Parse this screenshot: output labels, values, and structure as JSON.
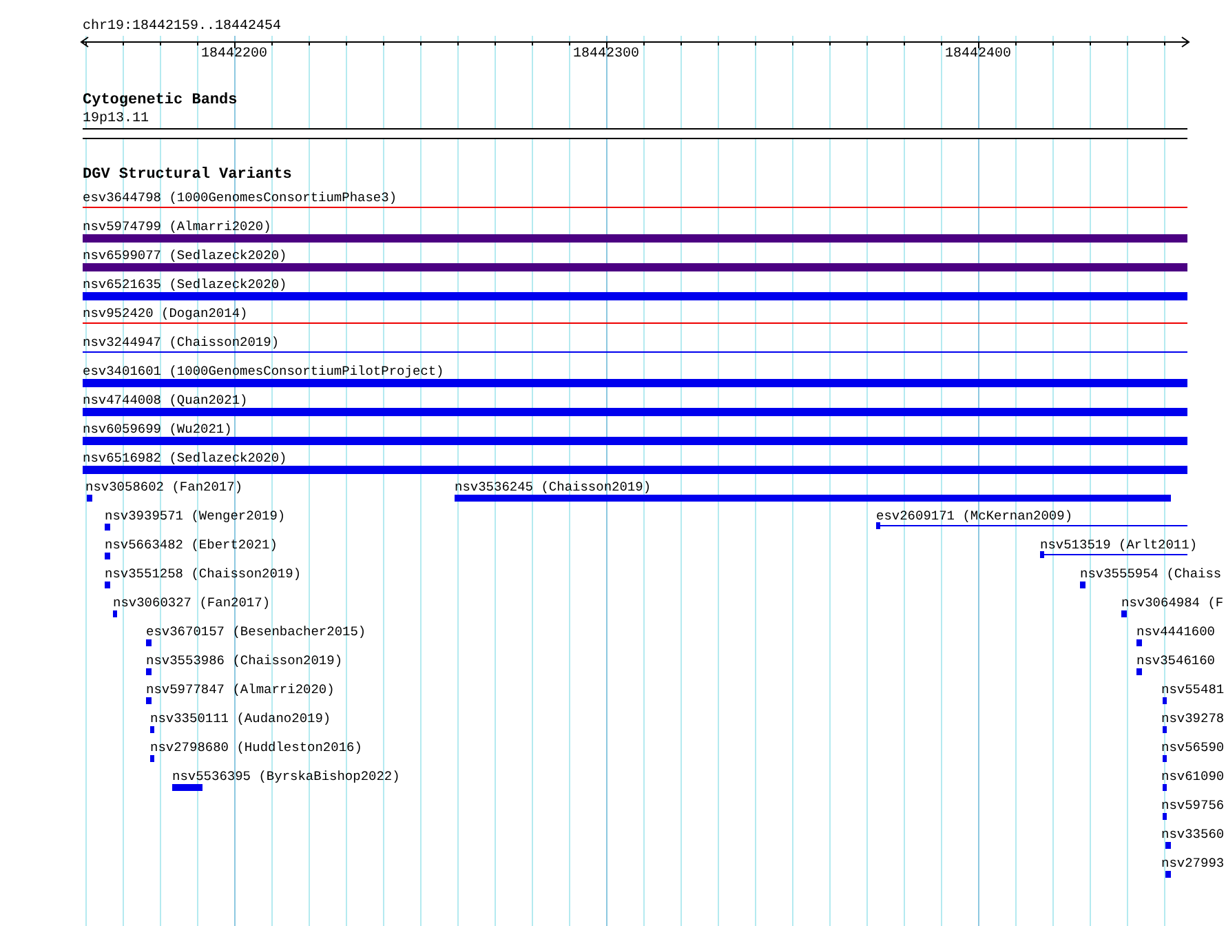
{
  "ruler": {
    "region": "chr19:18442159..18442454",
    "tick_labels": [
      "18442200",
      "18442300",
      "18442400"
    ]
  },
  "cytogenetic_bands": {
    "title": "Cytogenetic Bands",
    "band": "19p13.11"
  },
  "dgv_track": {
    "title": "DGV Structural Variants",
    "features": [
      {
        "label": "esv3644798 (1000GenomesConsortiumPhase3)",
        "kind": "line",
        "color": "#ee0000"
      },
      {
        "label": "nsv5974799 (Almarri2020)",
        "kind": "bar",
        "color": "#4b0082"
      },
      {
        "label": "nsv6599077 (Sedlazeck2020)",
        "kind": "bar",
        "color": "#4b0082"
      },
      {
        "label": "nsv6521635 (Sedlazeck2020)",
        "kind": "bar",
        "color": "#0000ee"
      },
      {
        "label": "nsv952420 (Dogan2014)",
        "kind": "line",
        "color": "#ee0000"
      },
      {
        "label": "nsv3244947 (Chaisson2019)",
        "kind": "line",
        "color": "#0000ee"
      },
      {
        "label": "esv3401601 (1000GenomesConsortiumPilotProject)",
        "kind": "bar",
        "color": "#0000ee"
      },
      {
        "label": "nsv4744008 (Quan2021)",
        "kind": "bar",
        "color": "#0000ee"
      },
      {
        "label": "nsv6059699 (Wu2021)",
        "kind": "bar",
        "color": "#0000ee"
      },
      {
        "label": "nsv6516982 (Sedlazeck2020)",
        "kind": "bar",
        "color": "#0000ee"
      },
      {
        "label": "nsv3058602 (Fan2017)",
        "kind": "bar",
        "color": "#0000ee"
      },
      {
        "label": "nsv3536245 (Chaisson2019)",
        "kind": "bar",
        "color": "#0000ee"
      },
      {
        "label": "nsv3939571 (Wenger2019)",
        "kind": "bar",
        "color": "#0000ee"
      },
      {
        "label": "esv2609171 (McKernan2009)",
        "kind": "ticked_line",
        "color": "#0000ee"
      },
      {
        "label": "nsv5663482 (Ebert2021)",
        "kind": "bar",
        "color": "#0000ee"
      },
      {
        "label": "nsv513519 (Arlt2011)",
        "kind": "ticked_line",
        "color": "#0000ee"
      },
      {
        "label": "nsv3551258 (Chaisson2019)",
        "kind": "bar",
        "color": "#0000ee"
      },
      {
        "label": "nsv3555954 (Chaiss",
        "kind": "bar",
        "color": "#0000ee"
      },
      {
        "label": "nsv3060327 (Fan2017)",
        "kind": "bar",
        "color": "#0000ee"
      },
      {
        "label": "nsv3064984 (F",
        "kind": "bar",
        "color": "#0000ee"
      },
      {
        "label": "esv3670157 (Besenbacher2015)",
        "kind": "bar",
        "color": "#0000ee"
      },
      {
        "label": "nsv4441600",
        "kind": "bar",
        "color": "#0000ee"
      },
      {
        "label": "nsv3553986 (Chaisson2019)",
        "kind": "bar",
        "color": "#0000ee"
      },
      {
        "label": "nsv3546160",
        "kind": "bar",
        "color": "#0000ee"
      },
      {
        "label": "nsv5977847 (Almarri2020)",
        "kind": "bar",
        "color": "#0000ee"
      },
      {
        "label": "nsv55481",
        "kind": "bar",
        "color": "#0000ee"
      },
      {
        "label": "nsv3350111 (Audano2019)",
        "kind": "bar",
        "color": "#0000ee"
      },
      {
        "label": "nsv39278",
        "kind": "bar",
        "color": "#0000ee"
      },
      {
        "label": "nsv2798680 (Huddleston2016)",
        "kind": "bar",
        "color": "#0000ee"
      },
      {
        "label": "nsv56590",
        "kind": "bar",
        "color": "#0000ee"
      },
      {
        "label": "nsv5536395 (ByrskaBishop2022)",
        "kind": "bar",
        "color": "#0000ee"
      },
      {
        "label": "nsv61090",
        "kind": "bar",
        "color": "#0000ee"
      },
      {
        "label": "nsv59756",
        "kind": "bar",
        "color": "#0000ee"
      },
      {
        "label": "nsv33560",
        "kind": "bar",
        "color": "#0000ee"
      },
      {
        "label": "nsv27993",
        "kind": "bar",
        "color": "#0000ee"
      }
    ]
  }
}
